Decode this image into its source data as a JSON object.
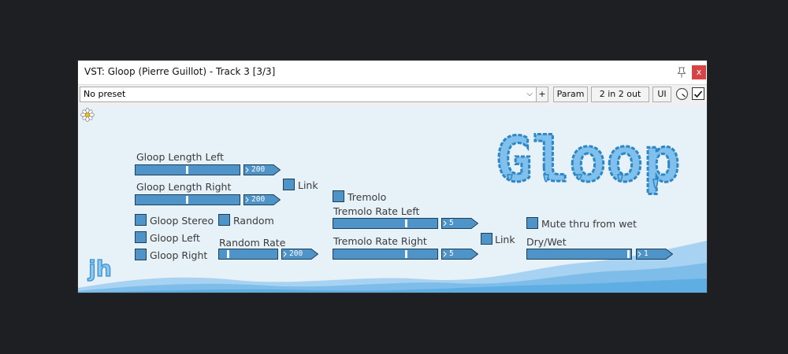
{
  "window": {
    "title": "VST: Gloop (Pierre Guillot) - Track 3 [3/3]",
    "close_glyph": "x"
  },
  "toolbar": {
    "preset_value": "No preset",
    "add_label": "+",
    "param_label": "Param",
    "io_label": "2 in 2 out",
    "ui_label": "UI",
    "enabled_checked": true
  },
  "plugin": {
    "logo_text": "Gloop",
    "brand_initials": "jh",
    "accent_color": "#4f94c8",
    "gloop_length_left": {
      "label": "Gloop Length Left",
      "value": "200",
      "level": 0.5
    },
    "gloop_length_right": {
      "label": "Gloop Length Right",
      "value": "200",
      "level": 0.5
    },
    "link_gloop": {
      "label": "Link"
    },
    "gloop_stereo": {
      "label": "Gloop Stereo"
    },
    "random": {
      "label": "Random"
    },
    "gloop_left": {
      "label": "Gloop Left"
    },
    "gloop_right": {
      "label": "Gloop Right"
    },
    "random_rate": {
      "label": "Random Rate",
      "value": "200",
      "level": 0.15
    },
    "tremolo": {
      "label": "Tremolo"
    },
    "tremolo_rate_left": {
      "label": "Tremolo Rate Left",
      "value": "5",
      "level": 0.72
    },
    "tremolo_rate_right": {
      "label": "Tremolo Rate Right",
      "value": "5",
      "level": 0.72
    },
    "link_tremolo": {
      "label": "Link"
    },
    "mute_thru": {
      "label": "Mute thru from wet"
    },
    "dry_wet": {
      "label": "Dry/Wet",
      "value": "1",
      "level": 1.0
    }
  }
}
